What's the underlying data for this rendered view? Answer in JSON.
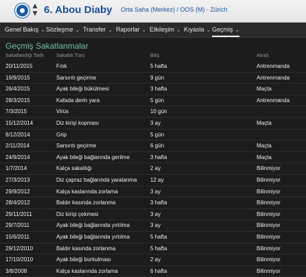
{
  "header": {
    "player_name": "6. Abou Diaby",
    "player_meta": "Orta Saha (Merkez) / OOS (M) - Zürich"
  },
  "tabs": [
    {
      "label": "Genel Bakış"
    },
    {
      "label": "Sözleşme"
    },
    {
      "label": "Transfer"
    },
    {
      "label": "Raporlar"
    },
    {
      "label": "Etkileşim"
    },
    {
      "label": "Kıyasla"
    },
    {
      "label": "Geçmiş"
    }
  ],
  "section": {
    "title": "Geçmiş Sakatlanmalar",
    "columns": {
      "date": "Sakatlandığı Tarih",
      "type": "Sakatlık Türü",
      "duration": "Bitiş",
      "location": "Alındı"
    }
  },
  "injuries": [
    {
      "date": "20/11/2015",
      "type": "Fıtık",
      "duration": "5 hafta",
      "location": "Antrenmanda"
    },
    {
      "date": "19/9/2015",
      "type": "Sarsıntı geçirme",
      "duration": "9 gün",
      "location": "Antrenmanda"
    },
    {
      "date": "26/4/2015",
      "type": "Ayak bileği bükülmesi",
      "duration": "3 hafta",
      "location": "Maçta"
    },
    {
      "date": "28/3/2015",
      "type": "Kafada derin yara",
      "duration": "5 gün",
      "location": "Antrenmanda"
    },
    {
      "date": "7/3/2015",
      "type": "Virüs",
      "duration": "10 gün",
      "location": ""
    },
    {
      "date": "15/12/2014",
      "type": "Diz kirişi kopması",
      "duration": "3 ay",
      "location": "Maçta"
    },
    {
      "date": "8/12/2014",
      "type": "Grip",
      "duration": "5 gün",
      "location": ""
    },
    {
      "date": "2/11/2014",
      "type": "Sarsıntı geçirme",
      "duration": "6 gün",
      "location": "Maçta"
    },
    {
      "date": "24/9/2014",
      "type": "Ayak bileği bağlarında gerilme",
      "duration": "3 hafta",
      "location": "Maçta"
    },
    {
      "date": "1/7/2014",
      "type": "Kalça sakatlığı",
      "duration": "2 ay",
      "location": "Bilinmiyor"
    },
    {
      "date": "27/3/2013",
      "type": "Diz çapraz bağlarında yaralanma",
      "duration": "12 ay",
      "location": "Bilinmiyor"
    },
    {
      "date": "29/9/2012",
      "type": "Kalça kaslarında zorlama",
      "duration": "3 ay",
      "location": "Bilinmiyor"
    },
    {
      "date": "28/4/2012",
      "type": "Baldır kasında zorlanma",
      "duration": "3 hafta",
      "location": "Bilinmiyor"
    },
    {
      "date": "29/11/2011",
      "type": "Diz kirişi çekmesi",
      "duration": "3 ay",
      "location": "Bilinmiyor"
    },
    {
      "date": "29/7/2011",
      "type": "Ayak bileği bağlarında yırtılma",
      "duration": "3 ay",
      "location": "Bilinmiyor"
    },
    {
      "date": "15/6/2011",
      "type": "Ayak bileği bağlarında yırtılma",
      "duration": "5 hafta",
      "location": "Bilinmiyor"
    },
    {
      "date": "29/12/2010",
      "type": "Baldır kasında zorlanma",
      "duration": "5 hafta",
      "location": "Bilinmiyor"
    },
    {
      "date": "17/10/2010",
      "type": "Ayak bileği burkulması",
      "duration": "2 ay",
      "location": "Bilinmiyor"
    },
    {
      "date": "3/8/2008",
      "type": "Kalça kaslarında zorlama",
      "duration": "6 hafta",
      "location": "Bilinmiyor"
    }
  ],
  "colors": {
    "accent_title": "#6fc1a8",
    "header_text": "#1b4f9c"
  }
}
